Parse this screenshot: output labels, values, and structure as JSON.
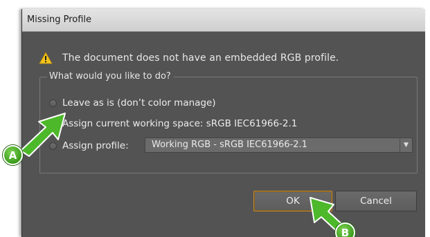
{
  "dialog": {
    "title": "Missing Profile",
    "message": "The document does not have an embedded RGB profile.",
    "group_legend": "What would you like to do?",
    "options": [
      {
        "label": "Leave as is (don’t color manage)",
        "selected": false
      },
      {
        "label": "Assign current working space: sRGB IEC61966-2.1",
        "selected": true
      },
      {
        "label": "Assign profile:",
        "selected": false
      }
    ],
    "profile_select": {
      "value": "Working RGB - sRGB IEC61966-2.1"
    },
    "buttons": {
      "ok": "OK",
      "cancel": "Cancel"
    }
  },
  "callouts": {
    "a": "A",
    "b": "B"
  },
  "colors": {
    "dialog_bg": "#535353",
    "accent_arrow": "#4cb82a",
    "ok_border": "#c58a2a",
    "warning": "#f2c21b"
  },
  "icons": {
    "warning": "warning-icon",
    "dropdown": "chevron-down-icon"
  }
}
